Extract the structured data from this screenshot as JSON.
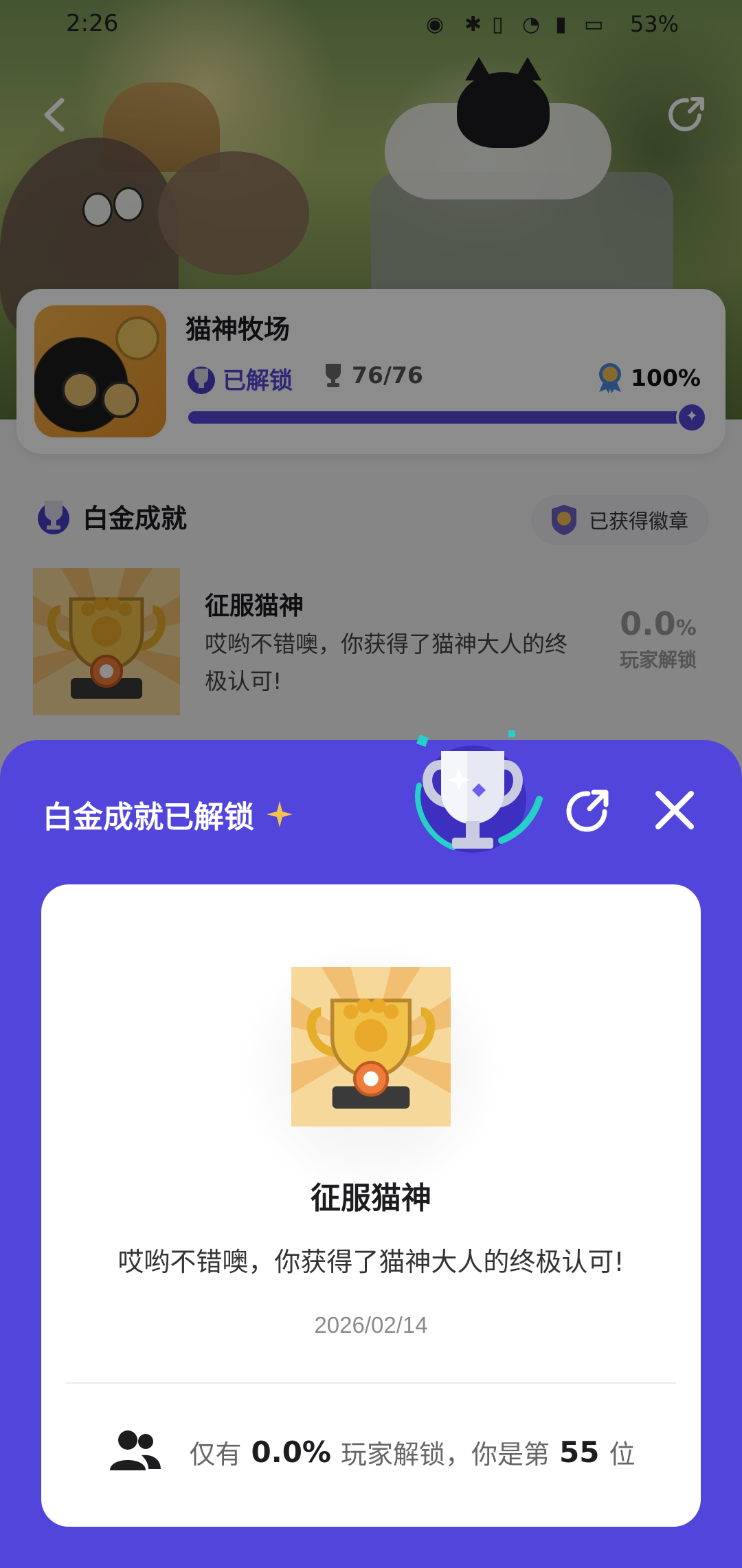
{
  "status_bar": {
    "time": "2:26",
    "battery": "53%"
  },
  "game": {
    "title": "猫神牧场",
    "unlocked_label": "已解锁",
    "trophy_count": "76/76",
    "completion": "100%",
    "progress": 1.0
  },
  "section": {
    "title": "白金成就",
    "badge_label": "已获得徽章"
  },
  "achievement": {
    "title": "征服猫神",
    "description": "哎哟不错噢，你获得了猫神大人的终极认可!",
    "rate_number": "0.0",
    "rate_unit": "%",
    "rate_label": "玩家解锁"
  },
  "sheet": {
    "title": "白金成就已解锁",
    "detail_title": "征服猫神",
    "detail_desc": "哎哟不错噢，你获得了猫神大人的终极认可!",
    "date": "2026/02/14",
    "stat_prefix": "仅有",
    "stat_rate": "0.0%",
    "stat_middle": "玩家解锁，你是第",
    "stat_rank": "55",
    "stat_suffix": "位"
  },
  "colors": {
    "accent": "#5145dc",
    "progress": "#5547d6",
    "gold": "#f3c24f"
  }
}
